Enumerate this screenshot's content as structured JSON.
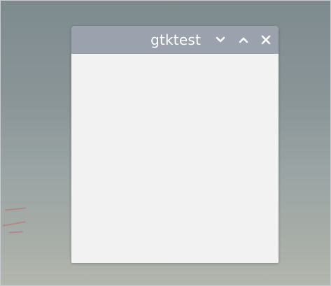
{
  "window": {
    "title": "gtktest",
    "buttons": {
      "minimize_icon": "chevron-down",
      "maximize_icon": "chevron-up",
      "close_icon": "x"
    }
  },
  "colors": {
    "titlebar": "#9ba2ad",
    "title_text": "#ffffff",
    "client_bg": "#f2f2f2"
  }
}
